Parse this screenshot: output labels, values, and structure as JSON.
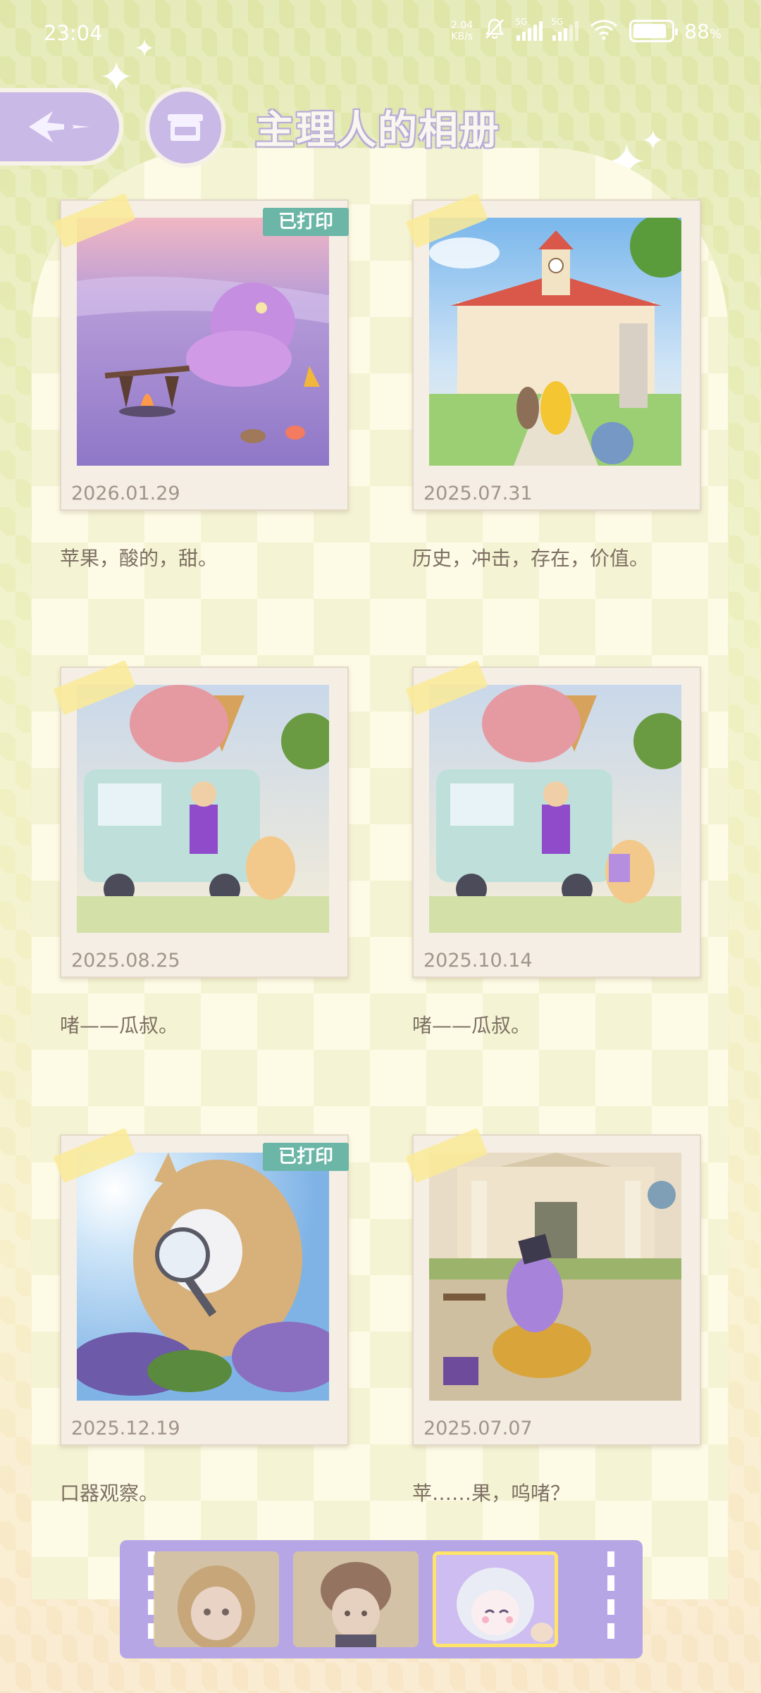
{
  "status_bar": {
    "time": "23:04",
    "speed_value": "2.04",
    "speed_unit": "KB/s",
    "network_1": "5G",
    "network_2": "5G",
    "battery_text": "88",
    "battery_percent_sign": "%",
    "battery_level": 0.88
  },
  "header": {
    "title": "主理人的相册"
  },
  "album": {
    "printed_label": "已打印",
    "photos": [
      {
        "date": "2026.01.29",
        "caption": "苹果，酸的，甜。",
        "printed": true
      },
      {
        "date": "2025.07.31",
        "caption": "历史，冲击，存在，价值。",
        "printed": false
      },
      {
        "date": "2025.08.25",
        "caption": "啫——瓜叔。",
        "printed": false
      },
      {
        "date": "2025.10.14",
        "caption": "啫——瓜叔。",
        "printed": false
      },
      {
        "date": "2025.12.19",
        "caption": "口器观察。",
        "printed": true
      },
      {
        "date": "2025.07.07",
        "caption": "苹……果，呜啫？",
        "printed": false
      }
    ]
  },
  "character_tabs": {
    "selected_index": 2,
    "count": 3
  },
  "colors": {
    "accent_purple": "#c9b9e6",
    "printed_badge": "#6bb6a7",
    "tab_active_border": "#ffe46a"
  }
}
